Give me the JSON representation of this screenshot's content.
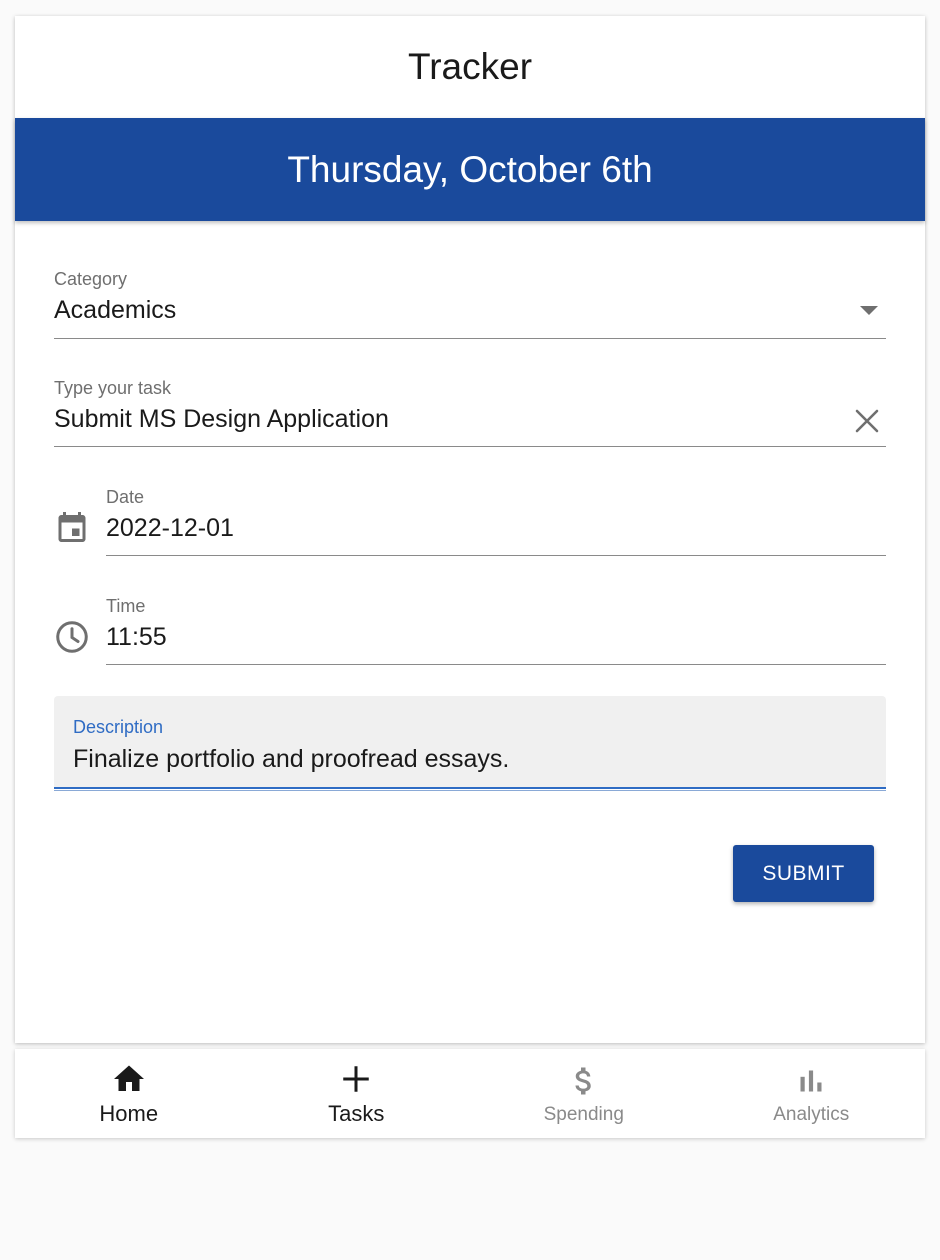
{
  "app": {
    "title": "Tracker",
    "date_banner": "Thursday, October 6th",
    "accent_color": "#1a4a9c"
  },
  "form": {
    "category": {
      "label": "Category",
      "value": "Academics",
      "icon": "dropdown-arrow-icon"
    },
    "task": {
      "label": "Type your task",
      "value": "Submit MS Design Application",
      "icon": "close-icon"
    },
    "date": {
      "label": "Date",
      "value": "2022-12-01",
      "icon": "calendar-icon"
    },
    "time": {
      "label": "Time",
      "value": "11:55",
      "icon": "clock-icon"
    },
    "description": {
      "label": "Description",
      "value": "Finalize portfolio and proofread essays."
    },
    "submit_label": "SUBMIT"
  },
  "bottom_nav": {
    "items": [
      {
        "label": "Home",
        "icon": "home-icon",
        "active": true
      },
      {
        "label": "Tasks",
        "icon": "plus-icon",
        "active": true
      },
      {
        "label": "Spending",
        "icon": "dollar-icon",
        "active": false
      },
      {
        "label": "Analytics",
        "icon": "bar-chart-icon",
        "active": false
      }
    ]
  }
}
